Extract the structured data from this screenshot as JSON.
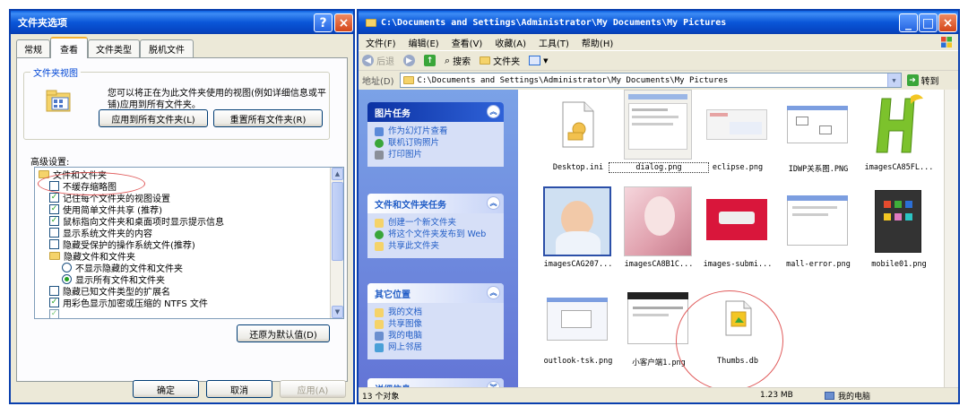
{
  "dialog": {
    "title": "文件夹选项",
    "help_btn": "?",
    "close_btn": "×",
    "tabs": [
      "常规",
      "查看",
      "文件类型",
      "脱机文件"
    ],
    "group_title": "文件夹视图",
    "description": "您可以将正在为此文件夹使用的视图(例如详细信息或平铺)应用到所有文件夹。",
    "apply_all": "应用到所有文件夹(L)",
    "reset_all": "重置所有文件夹(R)",
    "advanced_label": "高级设置:",
    "settings": [
      {
        "type": "folder",
        "label": "文件和文件夹",
        "level": 0
      },
      {
        "type": "check",
        "checked": false,
        "label": "不缓存缩略图",
        "level": 1
      },
      {
        "type": "check",
        "checked": true,
        "label": "记住每个文件夹的视图设置",
        "level": 1
      },
      {
        "type": "check",
        "checked": true,
        "label": "使用简单文件共享 (推荐)",
        "level": 1
      },
      {
        "type": "check",
        "checked": true,
        "label": "鼠标指向文件夹和桌面项时显示提示信息",
        "level": 1
      },
      {
        "type": "check",
        "checked": false,
        "label": "显示系统文件夹的内容",
        "level": 1
      },
      {
        "type": "check",
        "checked": false,
        "label": "隐藏受保护的操作系统文件(推荐)",
        "level": 1
      },
      {
        "type": "folder",
        "label": "隐藏文件和文件夹",
        "level": 1
      },
      {
        "type": "radio",
        "checked": false,
        "label": "不显示隐藏的文件和文件夹",
        "level": 2
      },
      {
        "type": "radio",
        "checked": true,
        "label": "显示所有文件和文件夹",
        "level": 2
      },
      {
        "type": "check",
        "checked": false,
        "label": "隐藏已知文件类型的扩展名",
        "level": 1
      },
      {
        "type": "check",
        "checked": true,
        "label": "用彩色显示加密或压缩的 NTFS 文件",
        "level": 1
      }
    ],
    "restore_defaults": "还原为默认值(D)",
    "ok": "确定",
    "cancel": "取消",
    "apply": "应用(A)"
  },
  "explorer": {
    "title": "C:\\Documents and Settings\\Administrator\\My Documents\\My Pictures",
    "menu": [
      "文件(F)",
      "编辑(E)",
      "查看(V)",
      "收藏(A)",
      "工具(T)",
      "帮助(H)"
    ],
    "toolbar": {
      "back": "后退",
      "search": "搜索",
      "folders": "文件夹"
    },
    "address_label": "地址(D)",
    "address": "C:\\Documents and Settings\\Administrator\\My Documents\\My Pictures",
    "go": "转到",
    "panels": [
      {
        "title": "图片任务",
        "style": "special",
        "links": [
          "作为幻灯片查看",
          "联机订购照片",
          "打印图片"
        ]
      },
      {
        "title": "文件和文件夹任务",
        "style": "normal",
        "links": [
          "创建一个新文件夹",
          "将这个文件夹发布到 Web",
          "共享此文件夹"
        ]
      },
      {
        "title": "其它位置",
        "style": "normal",
        "links": [
          "我的文档",
          "共享图像",
          "我的电脑",
          "网上邻居"
        ]
      },
      {
        "title": "详细信息",
        "style": "normal",
        "links": []
      }
    ],
    "files": [
      {
        "name": "Desktop.ini"
      },
      {
        "name": "dialog.png"
      },
      {
        "name": "eclipse.png"
      },
      {
        "name": "IDWP关系图.PNG"
      },
      {
        "name": "imagesCA85FL..."
      },
      {
        "name": "imagesCAG207..."
      },
      {
        "name": "imagesCA8B1C..."
      },
      {
        "name": "images-submi..."
      },
      {
        "name": "mall-error.png"
      },
      {
        "name": "mobile01.png"
      },
      {
        "name": "outlook-tsk.png"
      },
      {
        "name": "小客户端1.png"
      },
      {
        "name": "Thumbs.db"
      }
    ],
    "status": {
      "count": "13 个对象",
      "size": "1.23 MB",
      "zone": "我的电脑"
    }
  },
  "colors": {
    "xp_title": "#0a56d8",
    "face": "#ece9d8",
    "link": "#215dc6",
    "annotation": "#e05a5a"
  }
}
